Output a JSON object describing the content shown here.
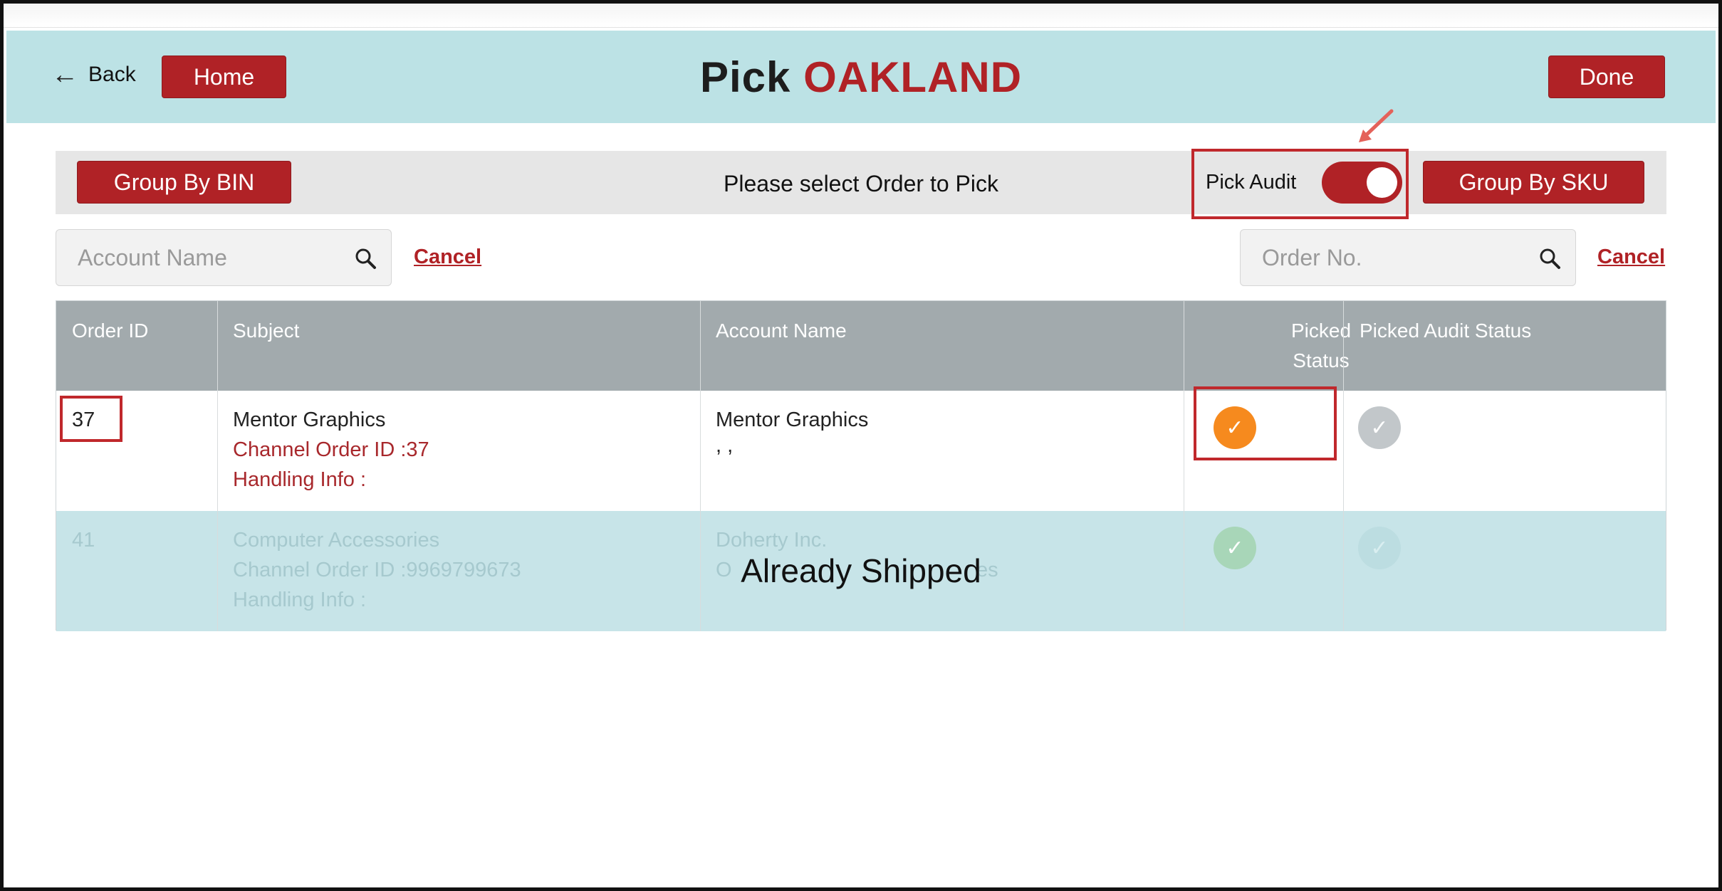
{
  "header": {
    "back_label": "Back",
    "home_label": "Home",
    "title_prefix": "Pick",
    "title_location": "OAKLAND",
    "done_label": "Done"
  },
  "toolbar": {
    "group_by_bin_label": "Group By BIN",
    "prompt": "Please select Order to Pick",
    "pick_audit_label": "Pick Audit",
    "pick_audit_on": true,
    "group_by_sku_label": "Group By SKU"
  },
  "search": {
    "account_placeholder": "Account Name",
    "order_placeholder": "Order No.",
    "cancel_label": "Cancel"
  },
  "table": {
    "columns": [
      "Order ID",
      "Subject",
      "Account Name",
      "Picked",
      "Status",
      "Picked Audit Status"
    ],
    "rows": [
      {
        "order_id": "37",
        "subject": "Mentor Graphics",
        "channel_order": "Channel Order ID :37",
        "handling": "Handling Info :",
        "account": "Mentor Graphics",
        "account_line2": ", ,",
        "picked_status": "picked",
        "audit_status": "pending"
      },
      {
        "order_id": "41",
        "subject": "Computer Accessories",
        "channel_order": "Channel Order ID :9969799673",
        "handling": "Handling Info :",
        "account": "Doherty Inc.",
        "account_line2": "O",
        "account_line2_end": "es",
        "picked_status": "picked",
        "audit_status": "pending",
        "overlay": "Already Shipped"
      }
    ]
  },
  "colors": {
    "brand_red": "#b02226",
    "header_bg": "#bce2e5",
    "picked_orange": "#f68a1e",
    "status_gray": "#c2c7ca",
    "shipped_green": "#a8d6b8"
  },
  "icons": {
    "back": "arrow-left-icon",
    "search": "magnifier-icon",
    "check": "check-icon"
  }
}
